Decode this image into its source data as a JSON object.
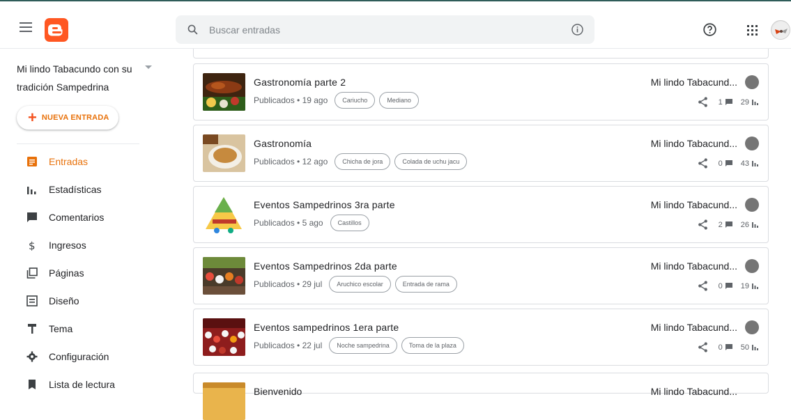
{
  "header": {
    "search_placeholder": "Buscar entradas"
  },
  "sidebar": {
    "blog_name": "Mi lindo Tabacundo con su tradición Sampedrina",
    "new_post_label": "NUEVA ENTRADA",
    "items": [
      {
        "label": "Entradas",
        "icon": "posts-icon",
        "active": true
      },
      {
        "label": "Estadísticas",
        "icon": "stats-icon"
      },
      {
        "label": "Comentarios",
        "icon": "comments-icon"
      },
      {
        "label": "Ingresos",
        "icon": "dollar-icon"
      },
      {
        "label": "Páginas",
        "icon": "pages-icon"
      },
      {
        "label": "Diseño",
        "icon": "layout-icon"
      },
      {
        "label": "Tema",
        "icon": "theme-icon"
      },
      {
        "label": "Configuración",
        "icon": "settings-icon"
      },
      {
        "label": "Lista de lectura",
        "icon": "bookmark-icon"
      }
    ]
  },
  "posts": [
    {
      "title": "Gastronomía parte 2",
      "status": "Publicados • 19 ago",
      "labels": [
        "Cariucho",
        "Mediano"
      ],
      "author": "Mi lindo Tabacund...",
      "comments": "1",
      "views": "29"
    },
    {
      "title": "Gastronomía",
      "status": "Publicados • 12 ago",
      "labels": [
        "Chicha de jora",
        "Colada de uchu jacu"
      ],
      "author": "Mi lindo Tabacund...",
      "comments": "0",
      "views": "43"
    },
    {
      "title": "Eventos Sampedrinos 3ra parte",
      "status": "Publicados • 5 ago",
      "labels": [
        "Castillos"
      ],
      "author": "Mi lindo Tabacund...",
      "comments": "2",
      "views": "26"
    },
    {
      "title": "Eventos Sampedrinos 2da parte",
      "status": "Publicados • 29 jul",
      "labels": [
        "Aruchico escolar",
        "Entrada de rama"
      ],
      "author": "Mi lindo Tabacund...",
      "comments": "0",
      "views": "19"
    },
    {
      "title": "Eventos sampedrinos 1era parte",
      "status": "Publicados • 22 jul",
      "labels": [
        "Noche sampedrina",
        "Toma de la plaza"
      ],
      "author": "Mi lindo Tabacund...",
      "comments": "0",
      "views": "50"
    }
  ],
  "partial_post": {
    "title": "Bienvenido",
    "author": "Mi lindo Tabacund..."
  },
  "colors": {
    "accent": "#e8710a",
    "logo": "#ff5722",
    "topline": "#2e5c59"
  }
}
